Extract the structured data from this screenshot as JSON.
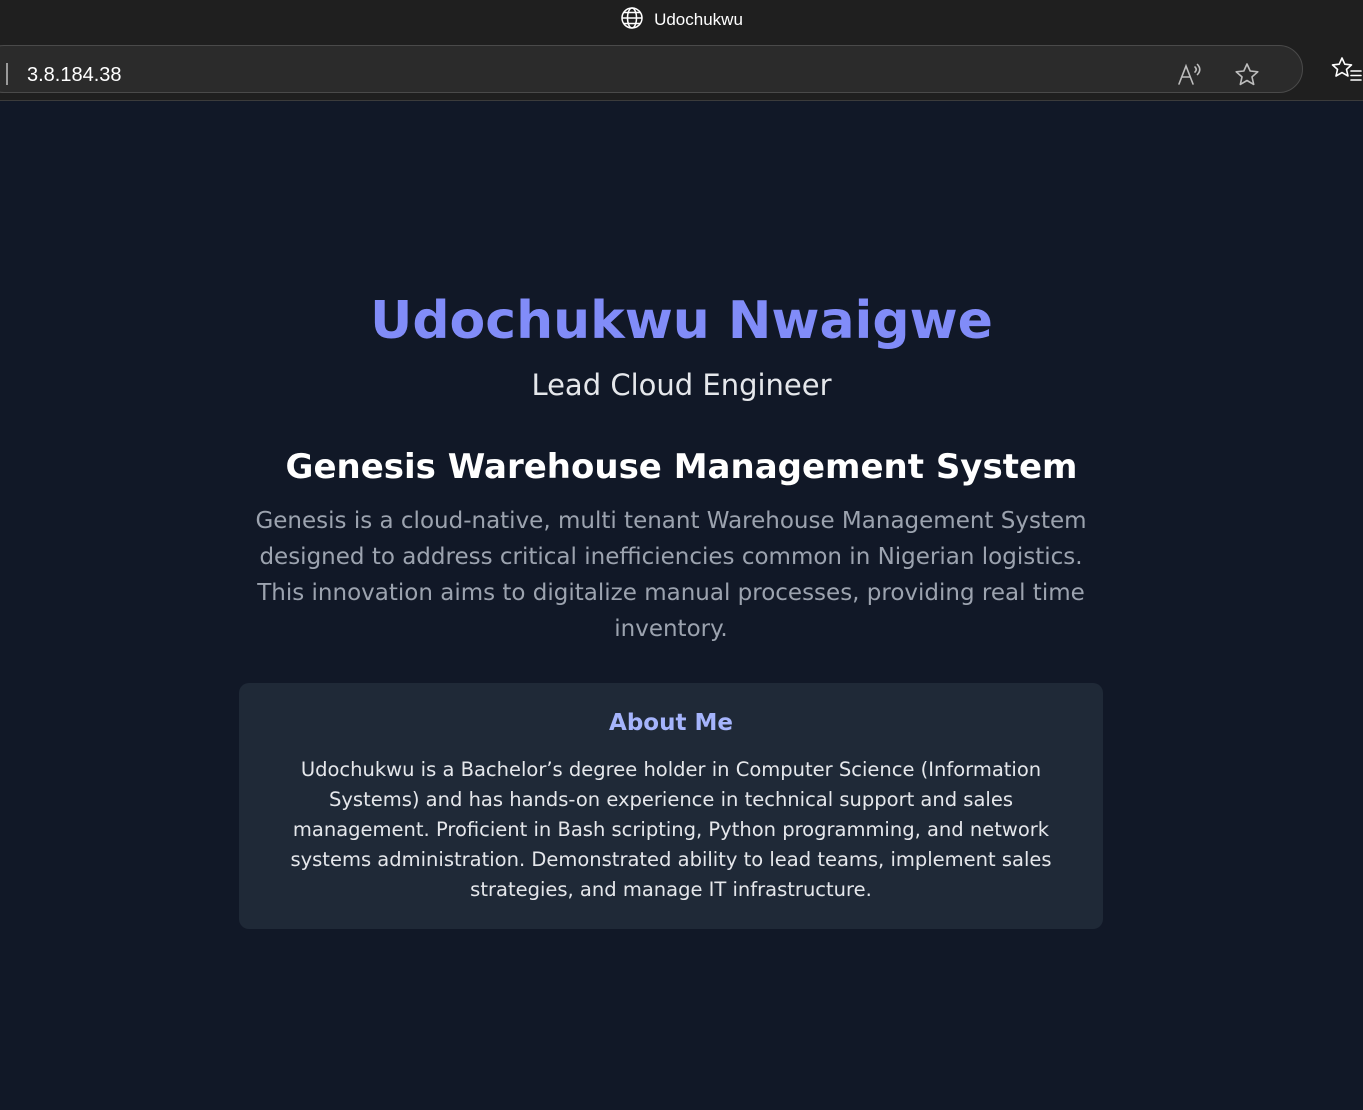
{
  "browser": {
    "tab_title": "Udochukwu",
    "url": "3.8.184.38",
    "icons": [
      "globe-icon",
      "read-aloud-icon",
      "favorite-star-icon",
      "favorites-list-icon"
    ]
  },
  "colors": {
    "page_bg": "#111827",
    "card_bg": "#1f2937",
    "accent": "#818cf8",
    "accent_light": "#a5b4fc",
    "muted_text": "#9ca3af"
  },
  "profile": {
    "name": "Udochukwu Nwaigwe",
    "role": "Lead Cloud Engineer"
  },
  "project": {
    "title": "Genesis Warehouse Management System",
    "description": "Genesis is a cloud-native, multi tenant Warehouse Management System designed to address critical inefficiencies common in Nigerian logistics. This innovation aims to digitalize manual processes, providing real time inventory."
  },
  "about": {
    "heading": "About Me",
    "text": "Udochukwu is a Bachelor’s degree holder in Computer Science (Information Systems) and has hands-on experience in technical support and sales management. Proficient in Bash scripting, Python programming, and network systems administration. Demonstrated ability to lead teams, implement sales strategies, and manage IT infrastructure."
  }
}
